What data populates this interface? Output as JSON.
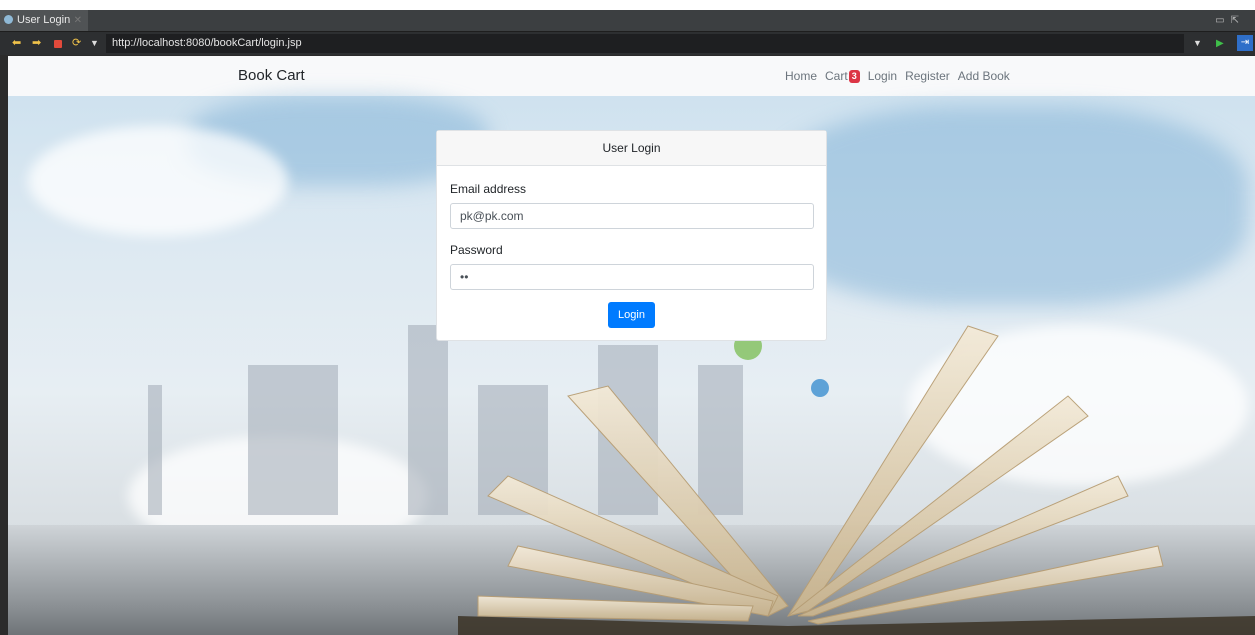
{
  "window": {
    "tab_title": "User Login",
    "url": "http://localhost:8080/bookCart/login.jsp"
  },
  "site": {
    "brand": "Book Cart",
    "nav": [
      {
        "label": "Home"
      },
      {
        "label": "Cart",
        "badge": "3"
      },
      {
        "label": "Login"
      },
      {
        "label": "Register"
      },
      {
        "label": "Add Book"
      }
    ]
  },
  "login": {
    "title": "User Login",
    "email_label": "Email address",
    "email_value": "pk@pk.com",
    "password_label": "Password",
    "password_value": "••",
    "submit_label": "Login"
  },
  "colors": {
    "primary": "#007bff",
    "badge": "#dc3545",
    "navbar_bg": "#f8f9fa"
  }
}
